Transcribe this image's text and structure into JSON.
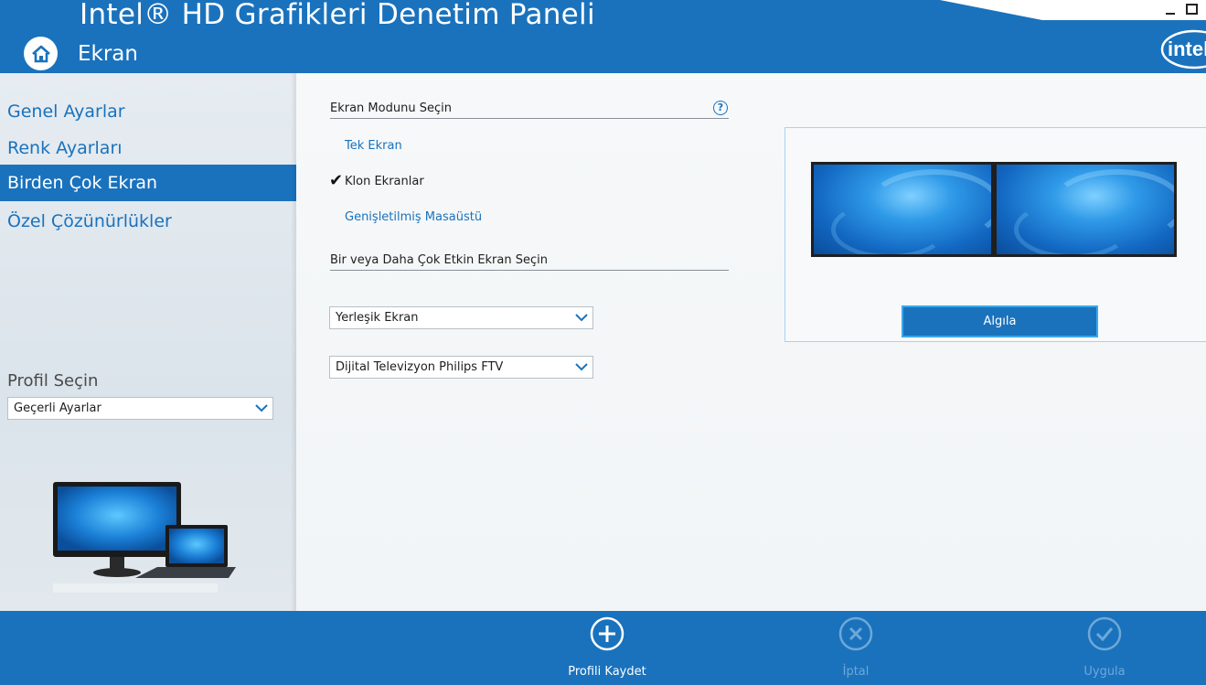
{
  "app": {
    "title": "Intel® HD Grafikleri Denetim Paneli",
    "section": "Ekran",
    "home_icon": "home-icon",
    "brand_color": "#1a72bd",
    "logo_text": "intel"
  },
  "sidebar": {
    "items": [
      {
        "label": "Genel Ayarlar",
        "active": false
      },
      {
        "label": "Renk Ayarları",
        "active": false
      },
      {
        "label": "Birden Çok Ekran",
        "active": true
      },
      {
        "label": "Özel Çözünürlükler",
        "active": false
      }
    ],
    "profile": {
      "label": "Profil Seçin",
      "selected": "Geçerli Ayarlar"
    }
  },
  "main": {
    "mode_section": {
      "heading": "Ekran Modunu Seçin",
      "help": "?",
      "options": [
        {
          "label": "Tek Ekran",
          "selected": false
        },
        {
          "label": "Klon Ekranlar",
          "selected": true
        },
        {
          "label": "Genişletilmiş Masaüstü",
          "selected": false
        }
      ]
    },
    "display_section": {
      "heading": "Bir veya Daha Çok Etkin Ekran Seçin",
      "dropdowns": [
        {
          "selected": "Yerleşik Ekran"
        },
        {
          "selected": "Dijital Televizyon Philips FTV"
        }
      ]
    },
    "preview": {
      "screens": 2,
      "detect_button": "Algıla"
    }
  },
  "footer": {
    "actions": [
      {
        "label": "Profili Kaydet",
        "icon": "plus-circle-icon",
        "enabled": true
      },
      {
        "label": "İptal",
        "icon": "close-circle-icon",
        "enabled": false
      },
      {
        "label": "Uygula",
        "icon": "check-circle-icon",
        "enabled": false
      }
    ]
  }
}
